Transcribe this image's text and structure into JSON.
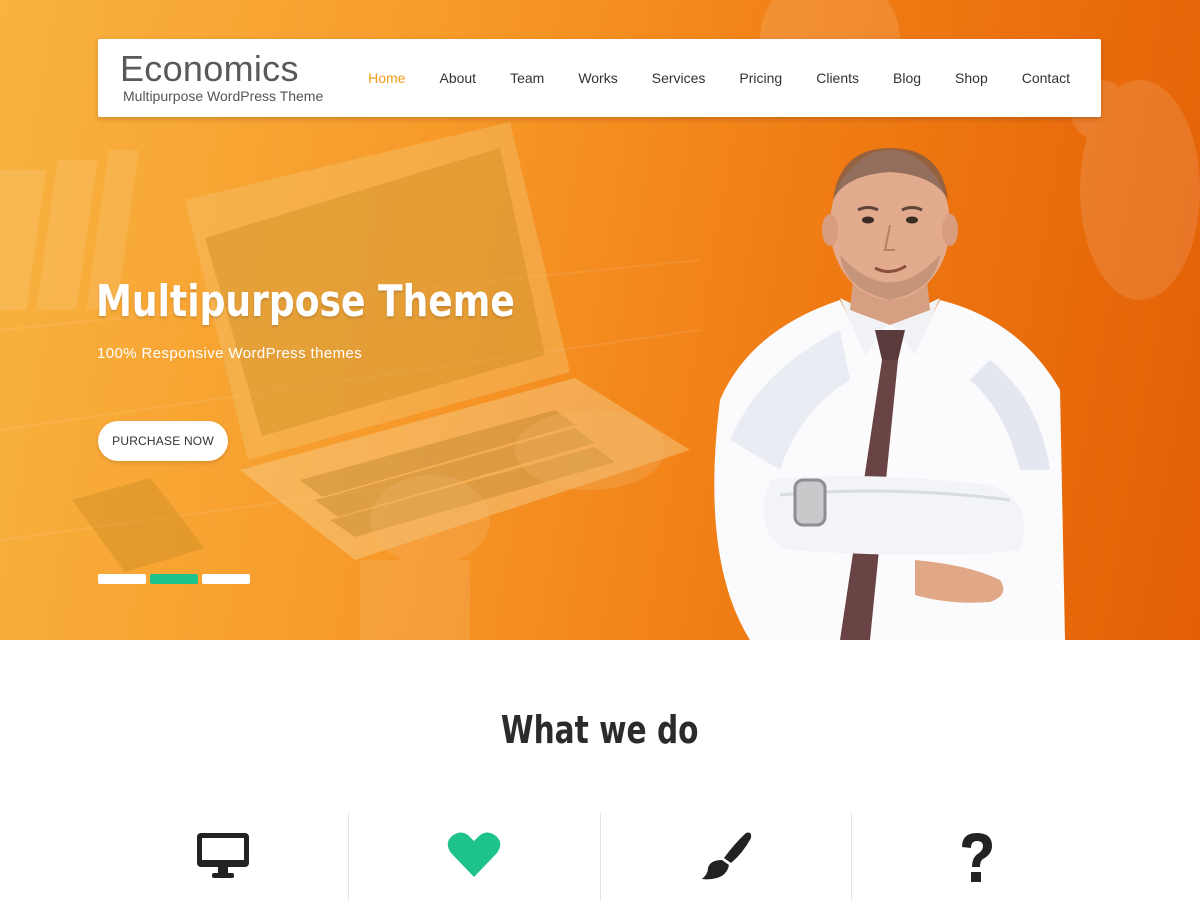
{
  "site": {
    "title": "Economics",
    "tagline": "Multipurpose WordPress Theme"
  },
  "nav": {
    "items": [
      {
        "label": "Home",
        "active": true
      },
      {
        "label": "About"
      },
      {
        "label": "Team"
      },
      {
        "label": "Works"
      },
      {
        "label": "Services"
      },
      {
        "label": "Pricing"
      },
      {
        "label": "Clients"
      },
      {
        "label": "Blog"
      },
      {
        "label": "Shop"
      },
      {
        "label": "Contact"
      }
    ]
  },
  "hero": {
    "title": "Multipurpose Theme",
    "subtitle": "100% Responsive WordPress themes",
    "button_label": "PURCHASE NOW",
    "slides": 3,
    "active_slide": 2
  },
  "section": {
    "title": "What we do"
  },
  "features": [
    {
      "icon": "desktop-icon",
      "color": "#222222"
    },
    {
      "icon": "heart-icon",
      "color": "#1ec28b"
    },
    {
      "icon": "paintbrush-icon",
      "color": "#222222"
    },
    {
      "icon": "question-icon",
      "color": "#222222"
    }
  ],
  "colors": {
    "accent": "#f29b1d",
    "green": "#1ec28b",
    "hero_start": "#f8b340",
    "hero_end": "#e35f05"
  }
}
